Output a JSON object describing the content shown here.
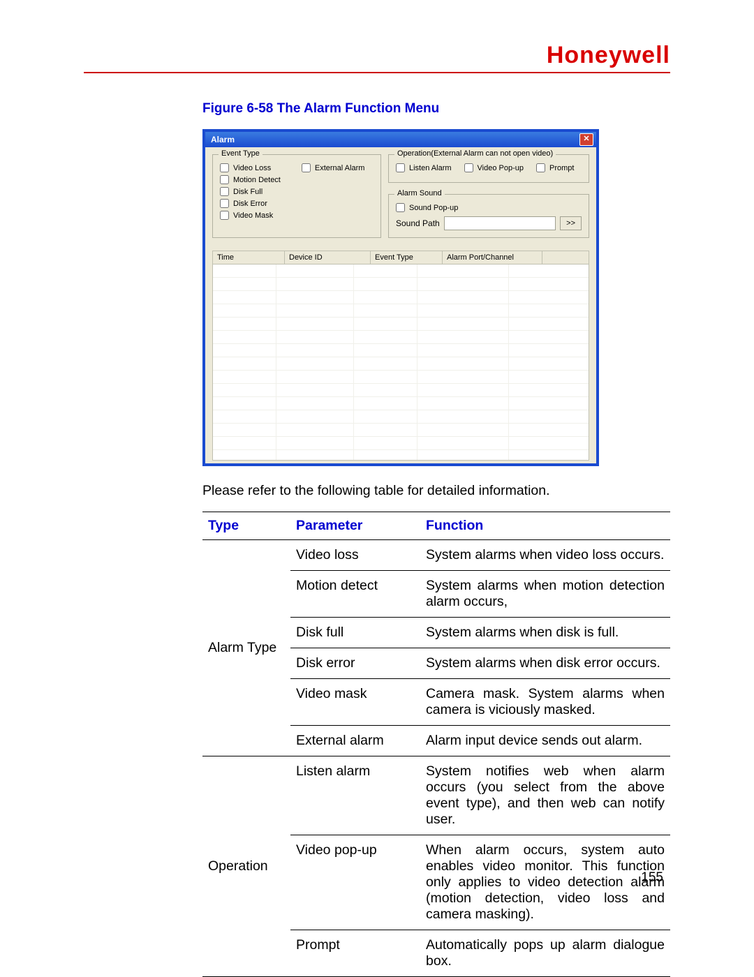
{
  "brand": "Honeywell",
  "figure_caption": "Figure 6-58 The Alarm Function Menu",
  "dialog": {
    "title": "Alarm",
    "event_type_group": "Event Type",
    "operation_group": "Operation(External Alarm can not open video)",
    "alarm_sound_group": "Alarm Sound",
    "checkboxes": {
      "video_loss": "Video Loss",
      "external_alarm": "External Alarm",
      "motion_detect": "Motion Detect",
      "disk_full": "Disk Full",
      "disk_error": "Disk Error",
      "video_mask": "Video Mask",
      "listen_alarm": "Listen Alarm",
      "video_popup": "Video Pop-up",
      "prompt": "Prompt",
      "sound_popup": "Sound Pop-up"
    },
    "sound_path_label": "Sound Path",
    "sound_path_value": "",
    "browse_btn": ">>",
    "grid_headers": {
      "time": "Time",
      "device_id": "Device ID",
      "event_type": "Event Type",
      "alarm_port": "Alarm Port/Channel"
    }
  },
  "desc_line": "Please refer to the following table for detailed information.",
  "table": {
    "head": {
      "type": "Type",
      "param": "Parameter",
      "func": "Function"
    },
    "sections": [
      {
        "type_label": "Alarm Type",
        "rows": [
          {
            "param": "Video loss",
            "func": "System alarms when video loss occurs."
          },
          {
            "param": "Motion detect",
            "func": "System alarms when motion detection alarm occurs,"
          },
          {
            "param": "Disk full",
            "func": "System alarms when disk is full."
          },
          {
            "param": "Disk error",
            "func": "System alarms when disk error occurs."
          },
          {
            "param": "Video mask",
            "func": "Camera mask. System alarms when camera is viciously masked."
          },
          {
            "param": "External alarm",
            "func": "Alarm input device sends out alarm."
          }
        ]
      },
      {
        "type_label": "Operation",
        "rows": [
          {
            "param": "Listen alarm",
            "func": "System notifies web when alarm occurs (you select from the above event type), and then web can notify user."
          },
          {
            "param": "Video pop-up",
            "func": "When alarm occurs, system auto enables video monitor. This function only applies to video detection alarm (motion detection, video loss and camera masking)."
          },
          {
            "param": "Prompt",
            "func": "Automatically pops up alarm dialogue box."
          }
        ]
      }
    ]
  },
  "page_number": "155"
}
